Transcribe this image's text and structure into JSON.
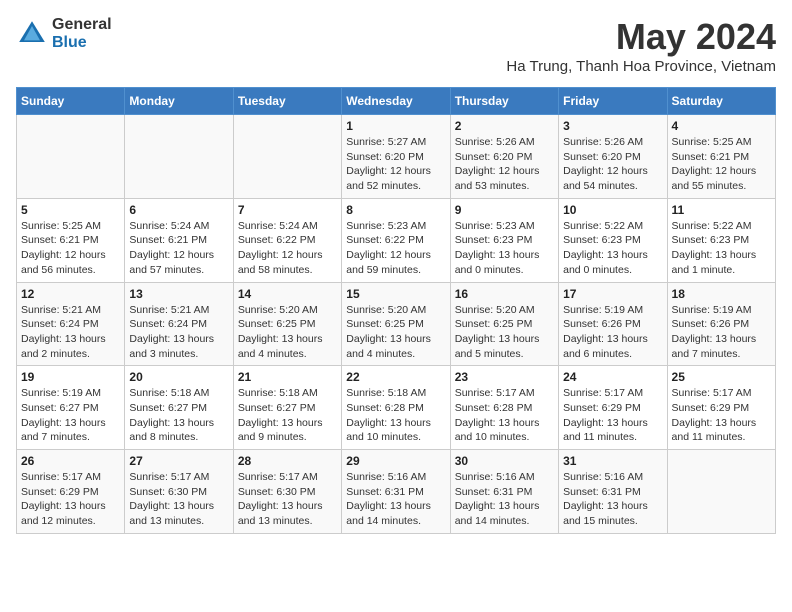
{
  "logo": {
    "general": "General",
    "blue": "Blue"
  },
  "title": "May 2024",
  "subtitle": "Ha Trung, Thanh Hoa Province, Vietnam",
  "headers": [
    "Sunday",
    "Monday",
    "Tuesday",
    "Wednesday",
    "Thursday",
    "Friday",
    "Saturday"
  ],
  "weeks": [
    [
      {
        "day": "",
        "info": ""
      },
      {
        "day": "",
        "info": ""
      },
      {
        "day": "",
        "info": ""
      },
      {
        "day": "1",
        "info": "Sunrise: 5:27 AM\nSunset: 6:20 PM\nDaylight: 12 hours\nand 52 minutes."
      },
      {
        "day": "2",
        "info": "Sunrise: 5:26 AM\nSunset: 6:20 PM\nDaylight: 12 hours\nand 53 minutes."
      },
      {
        "day": "3",
        "info": "Sunrise: 5:26 AM\nSunset: 6:20 PM\nDaylight: 12 hours\nand 54 minutes."
      },
      {
        "day": "4",
        "info": "Sunrise: 5:25 AM\nSunset: 6:21 PM\nDaylight: 12 hours\nand 55 minutes."
      }
    ],
    [
      {
        "day": "5",
        "info": "Sunrise: 5:25 AM\nSunset: 6:21 PM\nDaylight: 12 hours\nand 56 minutes."
      },
      {
        "day": "6",
        "info": "Sunrise: 5:24 AM\nSunset: 6:21 PM\nDaylight: 12 hours\nand 57 minutes."
      },
      {
        "day": "7",
        "info": "Sunrise: 5:24 AM\nSunset: 6:22 PM\nDaylight: 12 hours\nand 58 minutes."
      },
      {
        "day": "8",
        "info": "Sunrise: 5:23 AM\nSunset: 6:22 PM\nDaylight: 12 hours\nand 59 minutes."
      },
      {
        "day": "9",
        "info": "Sunrise: 5:23 AM\nSunset: 6:23 PM\nDaylight: 13 hours\nand 0 minutes."
      },
      {
        "day": "10",
        "info": "Sunrise: 5:22 AM\nSunset: 6:23 PM\nDaylight: 13 hours\nand 0 minutes."
      },
      {
        "day": "11",
        "info": "Sunrise: 5:22 AM\nSunset: 6:23 PM\nDaylight: 13 hours\nand 1 minute."
      }
    ],
    [
      {
        "day": "12",
        "info": "Sunrise: 5:21 AM\nSunset: 6:24 PM\nDaylight: 13 hours\nand 2 minutes."
      },
      {
        "day": "13",
        "info": "Sunrise: 5:21 AM\nSunset: 6:24 PM\nDaylight: 13 hours\nand 3 minutes."
      },
      {
        "day": "14",
        "info": "Sunrise: 5:20 AM\nSunset: 6:25 PM\nDaylight: 13 hours\nand 4 minutes."
      },
      {
        "day": "15",
        "info": "Sunrise: 5:20 AM\nSunset: 6:25 PM\nDaylight: 13 hours\nand 4 minutes."
      },
      {
        "day": "16",
        "info": "Sunrise: 5:20 AM\nSunset: 6:25 PM\nDaylight: 13 hours\nand 5 minutes."
      },
      {
        "day": "17",
        "info": "Sunrise: 5:19 AM\nSunset: 6:26 PM\nDaylight: 13 hours\nand 6 minutes."
      },
      {
        "day": "18",
        "info": "Sunrise: 5:19 AM\nSunset: 6:26 PM\nDaylight: 13 hours\nand 7 minutes."
      }
    ],
    [
      {
        "day": "19",
        "info": "Sunrise: 5:19 AM\nSunset: 6:27 PM\nDaylight: 13 hours\nand 7 minutes."
      },
      {
        "day": "20",
        "info": "Sunrise: 5:18 AM\nSunset: 6:27 PM\nDaylight: 13 hours\nand 8 minutes."
      },
      {
        "day": "21",
        "info": "Sunrise: 5:18 AM\nSunset: 6:27 PM\nDaylight: 13 hours\nand 9 minutes."
      },
      {
        "day": "22",
        "info": "Sunrise: 5:18 AM\nSunset: 6:28 PM\nDaylight: 13 hours\nand 10 minutes."
      },
      {
        "day": "23",
        "info": "Sunrise: 5:17 AM\nSunset: 6:28 PM\nDaylight: 13 hours\nand 10 minutes."
      },
      {
        "day": "24",
        "info": "Sunrise: 5:17 AM\nSunset: 6:29 PM\nDaylight: 13 hours\nand 11 minutes."
      },
      {
        "day": "25",
        "info": "Sunrise: 5:17 AM\nSunset: 6:29 PM\nDaylight: 13 hours\nand 11 minutes."
      }
    ],
    [
      {
        "day": "26",
        "info": "Sunrise: 5:17 AM\nSunset: 6:29 PM\nDaylight: 13 hours\nand 12 minutes."
      },
      {
        "day": "27",
        "info": "Sunrise: 5:17 AM\nSunset: 6:30 PM\nDaylight: 13 hours\nand 13 minutes."
      },
      {
        "day": "28",
        "info": "Sunrise: 5:17 AM\nSunset: 6:30 PM\nDaylight: 13 hours\nand 13 minutes."
      },
      {
        "day": "29",
        "info": "Sunrise: 5:16 AM\nSunset: 6:31 PM\nDaylight: 13 hours\nand 14 minutes."
      },
      {
        "day": "30",
        "info": "Sunrise: 5:16 AM\nSunset: 6:31 PM\nDaylight: 13 hours\nand 14 minutes."
      },
      {
        "day": "31",
        "info": "Sunrise: 5:16 AM\nSunset: 6:31 PM\nDaylight: 13 hours\nand 15 minutes."
      },
      {
        "day": "",
        "info": ""
      }
    ]
  ]
}
